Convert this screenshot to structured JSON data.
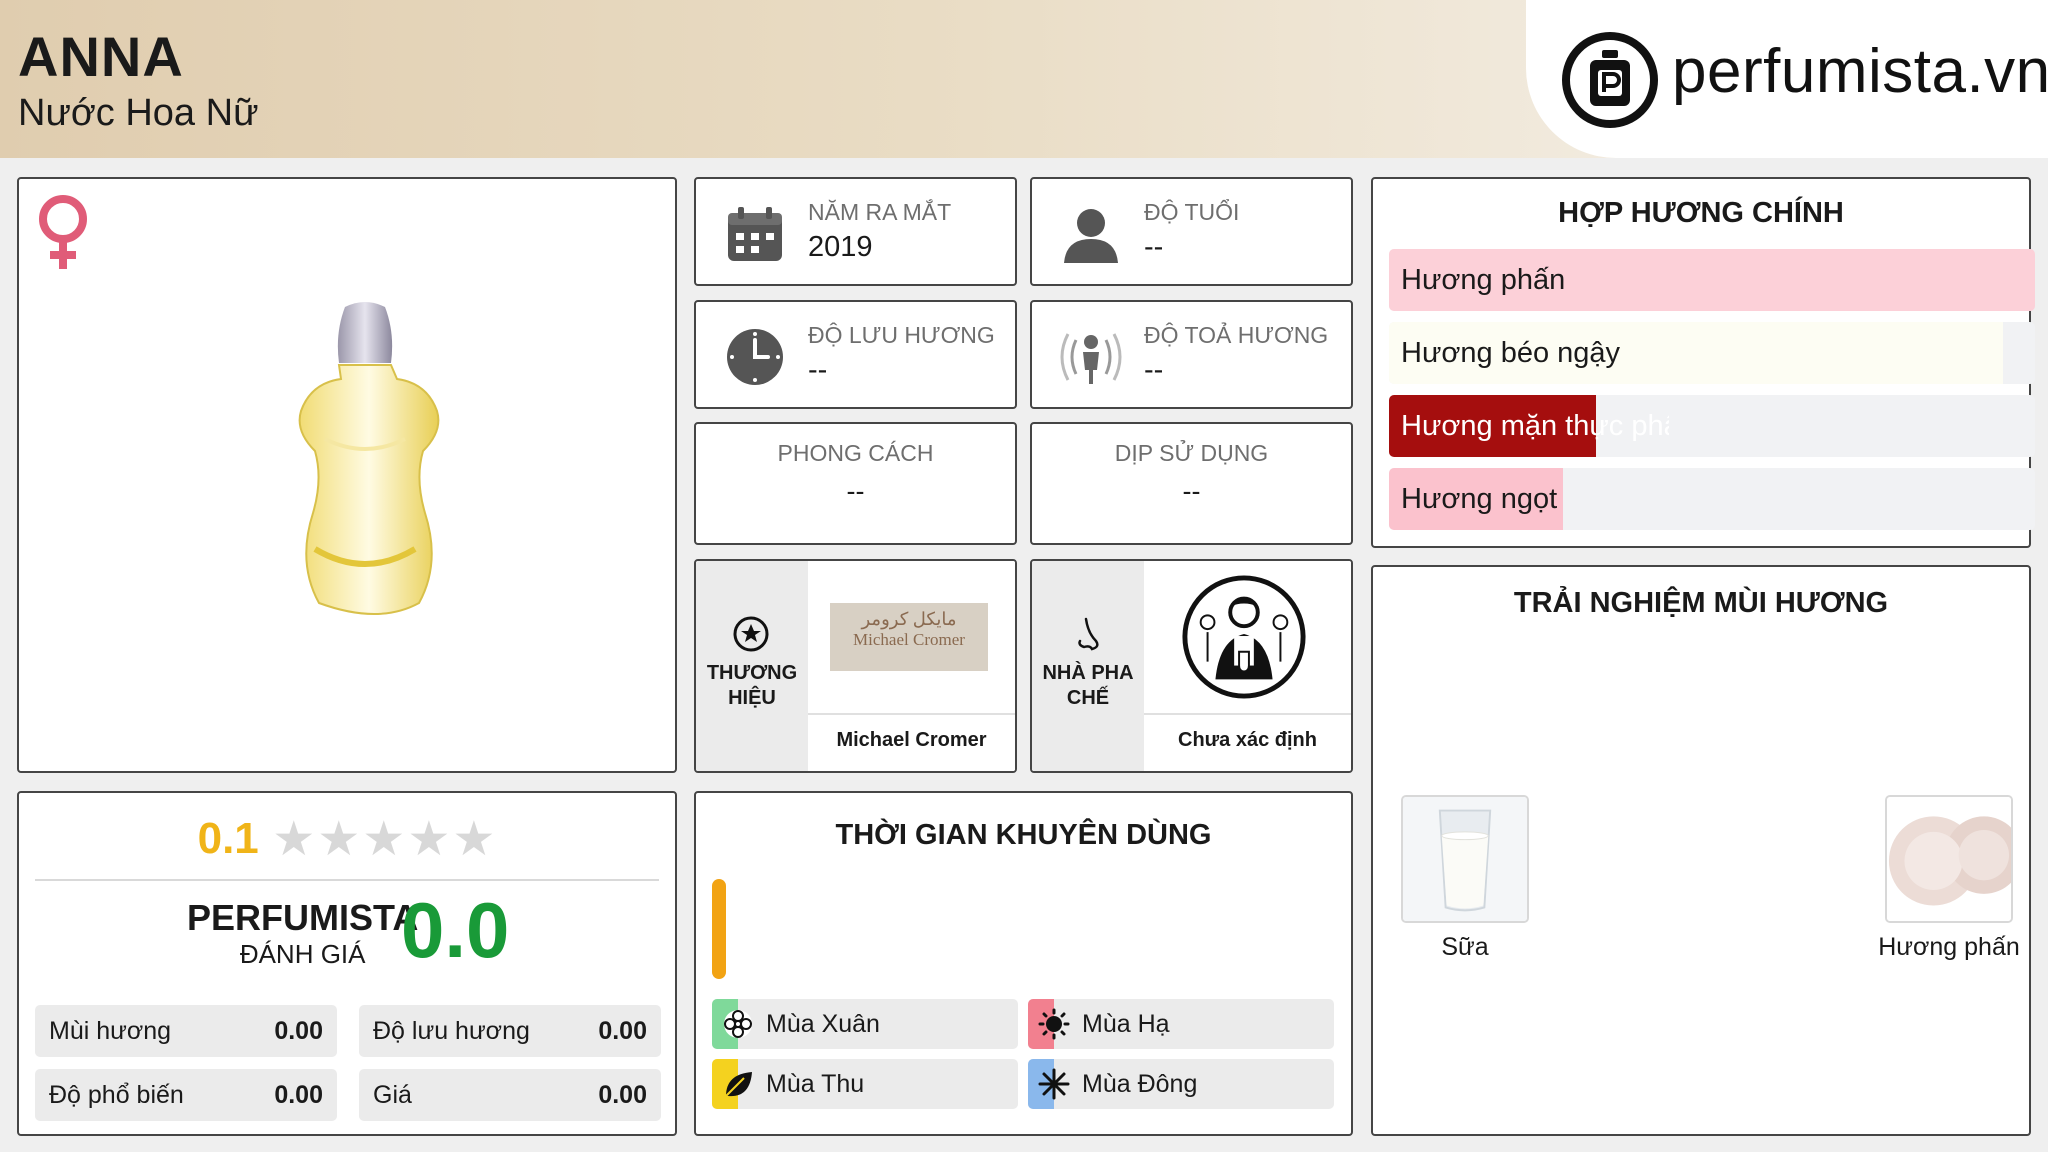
{
  "header": {
    "title": "ANNA",
    "subtitle": "Nước Hoa Nữ",
    "logo_text": "perfumista.vn"
  },
  "rating": {
    "score": "0.1",
    "stars_filled": 0,
    "brand_label": "PERFUMISTA",
    "brand_sub": "ĐÁNH GIÁ",
    "brand_score": "0.0",
    "metrics": [
      {
        "name": "Mùi hương",
        "value": "0.00"
      },
      {
        "name": "Độ lưu hương",
        "value": "0.00"
      },
      {
        "name": "Độ phổ biến",
        "value": "0.00"
      },
      {
        "name": "Giá",
        "value": "0.00"
      }
    ]
  },
  "info": {
    "year": {
      "label": "NĂM RA MẮT",
      "value": "2019",
      "icon": "calendar-icon"
    },
    "age": {
      "label": "ĐỘ TUỔI",
      "value": "--",
      "icon": "person-icon"
    },
    "longevity": {
      "label": "ĐỘ LƯU HƯƠNG",
      "value": "--",
      "icon": "clock-icon"
    },
    "sillage": {
      "label": "ĐỘ TOẢ HƯƠNG",
      "value": "--",
      "icon": "diffusion-icon"
    },
    "style": {
      "label": "PHONG CÁCH",
      "value": "--"
    },
    "occasion": {
      "label": "DỊP SỬ DỤNG",
      "value": "--"
    }
  },
  "brand": {
    "label": "THƯƠNG HIỆU",
    "logo_arabic": "مايكل كرومر",
    "logo_latin": "Michael Cromer",
    "name": "Michael Cromer"
  },
  "perfumer": {
    "label": "NHÀ PHA CHẾ",
    "name": "Chưa xác định"
  },
  "time": {
    "title": "THỜI GIAN KHUYÊN DÙNG",
    "seasons": [
      {
        "name": "Mùa Xuân",
        "color": "#7fd99a",
        "icon": "flower-icon"
      },
      {
        "name": "Mùa Hạ",
        "color": "#f2808f",
        "icon": "sun-icon"
      },
      {
        "name": "Mùa Thu",
        "color": "#f4d21f",
        "icon": "leaf-icon"
      },
      {
        "name": "Mùa Đông",
        "color": "#8ab8ec",
        "icon": "snowflake-icon"
      }
    ]
  },
  "accords": {
    "title": "HỢP HƯƠNG CHÍNH",
    "items": [
      {
        "name": "Hương phấn",
        "level": 1.0,
        "color": "#fcd0d8",
        "text_color": "#1a1a1a"
      },
      {
        "name": "Hương béo ngậy",
        "level": 0.95,
        "color": "#fdfdf3",
        "text_color": "#1a1a1a"
      },
      {
        "name": "Hương mặn thực phẩm",
        "level": 0.32,
        "color": "#a50e0e",
        "text_color": "#ffffff"
      },
      {
        "name": "Hương ngọt",
        "level": 0.27,
        "color": "#fbc2cd",
        "text_color": "#1a1a1a"
      }
    ]
  },
  "experience": {
    "title": "TRẢI NGHIỆM MÙI HƯƠNG",
    "notes": [
      {
        "name": "Sữa",
        "icon": "milk-glass-icon"
      },
      {
        "name": "Hương phấn",
        "icon": "powder-icon"
      }
    ]
  }
}
